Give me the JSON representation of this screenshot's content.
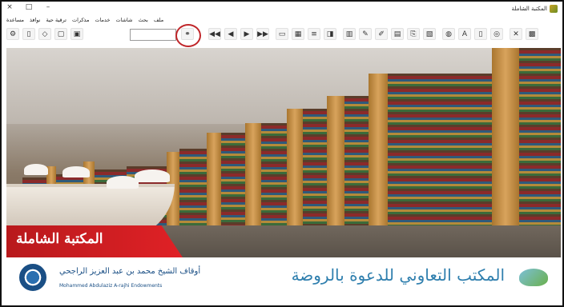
{
  "window": {
    "title": "المكتبة الشاملة",
    "controls": {
      "close": "×",
      "maximize": "□",
      "minimize": "–"
    }
  },
  "menu": {
    "items": [
      "مساعدة",
      "نوافذ",
      "ترقية حية",
      "مذكرات",
      "خدمات",
      "شاشات",
      "بحث",
      "ملف"
    ]
  },
  "toolbar": {
    "search_value": "",
    "buttons": [
      {
        "name": "settings-icon",
        "glyph": "⚙"
      },
      {
        "name": "page-icon",
        "glyph": "▯"
      },
      {
        "name": "navigate-icon",
        "glyph": "◇"
      },
      {
        "name": "open-book-icon",
        "glyph": "▢"
      },
      {
        "name": "book-icon",
        "glyph": "▣"
      },
      {
        "name": "binoculars-icon",
        "glyph": "⚭"
      },
      {
        "name": "first-icon",
        "glyph": "◀◀"
      },
      {
        "name": "prev-icon",
        "glyph": "◀"
      },
      {
        "name": "next-icon",
        "glyph": "▶"
      },
      {
        "name": "last-icon",
        "glyph": "▶▶"
      },
      {
        "name": "window-icon",
        "glyph": "▭"
      },
      {
        "name": "grid-icon",
        "glyph": "▦"
      },
      {
        "name": "list-icon",
        "glyph": "≡"
      },
      {
        "name": "bookmark-icon",
        "glyph": "◨"
      },
      {
        "name": "image-icon",
        "glyph": "▥"
      },
      {
        "name": "tag-icon",
        "glyph": "✎"
      },
      {
        "name": "pencil-icon",
        "glyph": "✐"
      },
      {
        "name": "gallery-icon",
        "glyph": "▤"
      },
      {
        "name": "copy-icon",
        "glyph": "⎘"
      },
      {
        "name": "doc-icon",
        "glyph": "▧"
      },
      {
        "name": "filter-icon",
        "glyph": "◍"
      },
      {
        "name": "text-icon",
        "glyph": "A"
      },
      {
        "name": "new-icon",
        "glyph": "▯"
      },
      {
        "name": "database-icon",
        "glyph": "◎"
      },
      {
        "name": "tools-icon",
        "glyph": "✕"
      },
      {
        "name": "export-icon",
        "glyph": "▩"
      }
    ]
  },
  "hero": {
    "logo_text": "المكتبة الشاملة"
  },
  "footer": {
    "left_arabic": "أوقاف الشيخ محمد بن عبد العزيز الراجحي",
    "left_english": "Mohammed Abdulaziz A-rajhi Endowments",
    "right_arabic": "المكتب التعاوني للدعوة بالروضة"
  }
}
